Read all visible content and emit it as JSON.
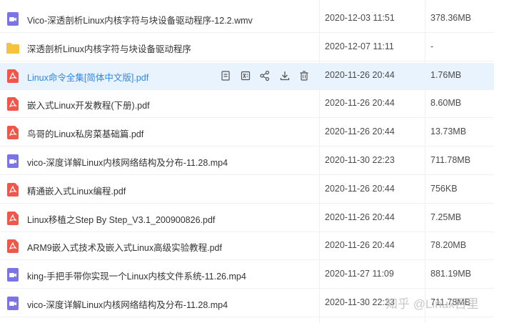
{
  "files": [
    {
      "name": "Vico-深透剖析Linux内核字符与块设备驱动程序-12.2.wmv",
      "date": "2020-12-03 11:51",
      "size": "378.36MB",
      "type": "video"
    },
    {
      "name": "深透剖析Linux内核字符与块设备驱动程序",
      "date": "2020-12-07 11:11",
      "size": "-",
      "type": "folder"
    },
    {
      "name": "Linux命令全集[简体中文版].pdf",
      "date": "2020-11-26 20:44",
      "size": "1.76MB",
      "type": "pdf"
    },
    {
      "name": "嵌入式Linux开发教程(下册).pdf",
      "date": "2020-11-26 20:44",
      "size": "8.60MB",
      "type": "pdf"
    },
    {
      "name": "鸟哥的Linux私房菜基础篇.pdf",
      "date": "2020-11-26 20:44",
      "size": "13.73MB",
      "type": "pdf"
    },
    {
      "name": "vico-深度详解Linux内核网络结构及分布-11.28.mp4",
      "date": "2020-11-30 22:23",
      "size": "711.78MB",
      "type": "video"
    },
    {
      "name": "精通嵌入式Linux编程.pdf",
      "date": "2020-11-26 20:44",
      "size": "756KB",
      "type": "pdf"
    },
    {
      "name": "Linux移植之Step By Step_V3.1_200900826.pdf",
      "date": "2020-11-26 20:44",
      "size": "7.25MB",
      "type": "pdf"
    },
    {
      "name": "ARM9嵌入式技术及嵌入式Linux高级实验教程.pdf",
      "date": "2020-11-26 20:44",
      "size": "78.20MB",
      "type": "pdf"
    },
    {
      "name": "king-手把手带你实现一个Linux内核文件系统-11.26.mp4",
      "date": "2020-11-27 11:09",
      "size": "881.19MB",
      "type": "video"
    },
    {
      "name": "vico-深度详解Linux内核网络结构及分布-11.28.mp4",
      "date": "2020-11-30 22:23",
      "size": "711.78MB",
      "type": "video"
    }
  ],
  "selected_index": 2,
  "row_actions": [
    "document-icon",
    "excel-icon",
    "share-icon",
    "download-icon",
    "delete-icon"
  ],
  "watermark": "知乎 @Linux百里",
  "colors": {
    "video": "#7b74e6",
    "folder": "#f5c33b",
    "pdf": "#f0564a",
    "accent": "#2f86e8",
    "selected_bg": "#e8f3fe"
  }
}
